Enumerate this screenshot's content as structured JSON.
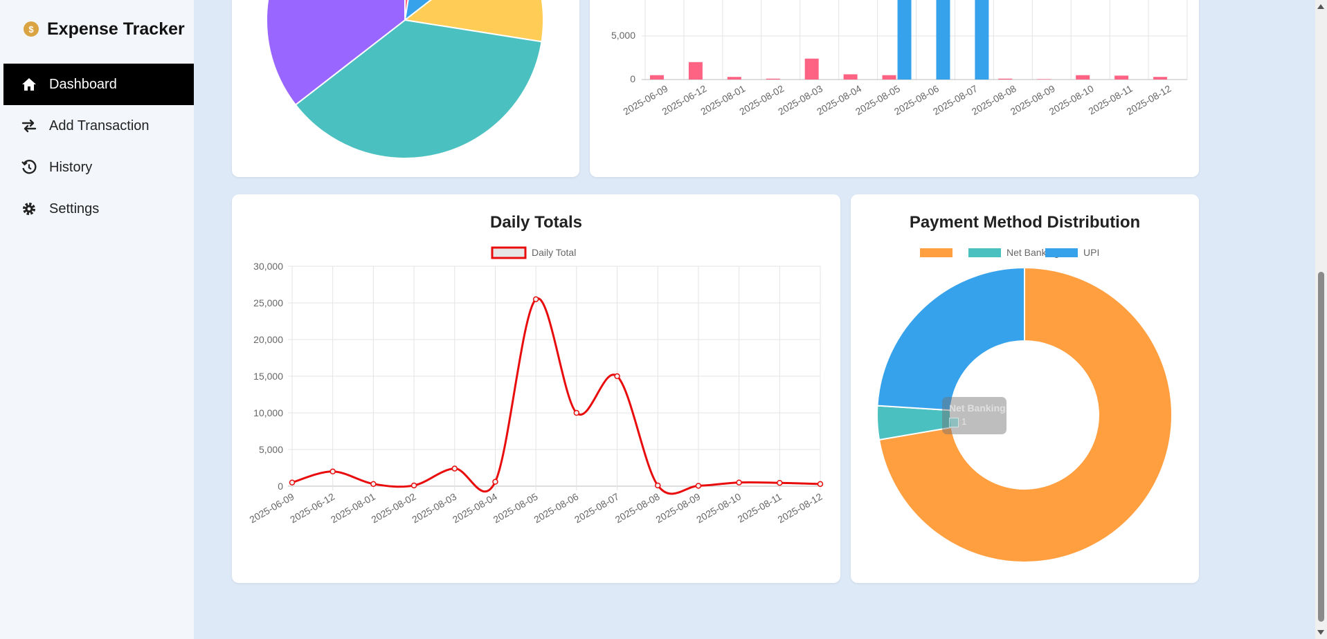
{
  "app": {
    "brand_icon": "money-bag-icon",
    "brand_title": "Expense Tracker"
  },
  "sidebar": {
    "items": [
      {
        "label": "Dashboard",
        "icon": "home-icon",
        "active": true
      },
      {
        "label": "Add Transaction",
        "icon": "exchange-icon",
        "active": false
      },
      {
        "label": "History",
        "icon": "history-icon",
        "active": false
      },
      {
        "label": "Settings",
        "icon": "gear-icon",
        "active": false
      }
    ]
  },
  "colors": {
    "line": "#e80c0c",
    "pink": "#ff6384",
    "blue": "#36a2eb",
    "teal": "#4bc0c0",
    "yellow": "#ffcd56",
    "purple": "#9966ff",
    "orange": "#ff9f40"
  },
  "chart_data": [
    {
      "type": "pie",
      "visible": "partial",
      "slices": [
        {
          "color": "#ff6384",
          "value": 2.5
        },
        {
          "color": "#36a2eb",
          "value": 12
        },
        {
          "color": "#ffcd56",
          "value": 13
        },
        {
          "color": "#4bc0c0",
          "value": 37
        },
        {
          "color": "#9966ff",
          "value": 35.5
        }
      ]
    },
    {
      "type": "bar",
      "visible": "partial",
      "categories": [
        "2025-06-09",
        "2025-06-12",
        "2025-08-01",
        "2025-08-02",
        "2025-08-03",
        "2025-08-04",
        "2025-08-05",
        "2025-08-06",
        "2025-08-07",
        "2025-08-08",
        "2025-08-09",
        "2025-08-10",
        "2025-08-11",
        "2025-08-12"
      ],
      "y_ticks": [
        "0",
        "5,000"
      ],
      "series": [
        {
          "color": "#ff6384",
          "values": [
            500,
            2000,
            300,
            100,
            2400,
            600,
            500,
            0,
            0,
            100,
            50,
            500,
            450,
            300
          ]
        },
        {
          "color": "#36a2eb",
          "values": [
            0,
            0,
            0,
            0,
            0,
            0,
            25000,
            10000,
            15000,
            0,
            0,
            0,
            0,
            0
          ]
        }
      ]
    },
    {
      "type": "line",
      "title": "Daily Totals",
      "legend": [
        "Daily Total"
      ],
      "categories": [
        "2025-06-09",
        "2025-06-12",
        "2025-08-01",
        "2025-08-02",
        "2025-08-03",
        "2025-08-04",
        "2025-08-05",
        "2025-08-06",
        "2025-08-07",
        "2025-08-08",
        "2025-08-09",
        "2025-08-10",
        "2025-08-11",
        "2025-08-12"
      ],
      "y_ticks": [
        "0",
        "5,000",
        "10,000",
        "15,000",
        "20,000",
        "25,000",
        "30,000"
      ],
      "ylim": [
        0,
        30000
      ],
      "series": [
        {
          "name": "Daily Total",
          "values": [
            500,
            2000,
            300,
            100,
            2400,
            600,
            25500,
            10000,
            15000,
            100,
            50,
            500,
            450,
            300
          ]
        }
      ]
    },
    {
      "type": "doughnut",
      "title": "Payment Method Distribution",
      "legend": [
        {
          "label": "",
          "color": "#ff9f40"
        },
        {
          "label": "Net Banking",
          "color": "#4bc0c0"
        },
        {
          "label": "UPI",
          "color": "#36a2eb"
        }
      ],
      "slices": [
        {
          "label": "",
          "color": "#ff9f40",
          "value": 72.3
        },
        {
          "label": "Net Banking",
          "color": "#4bc0c0",
          "value": 3.7
        },
        {
          "label": "UPI",
          "color": "#36a2eb",
          "value": 24
        }
      ],
      "tooltip": {
        "title": "Net Banking",
        "value": "1"
      }
    }
  ]
}
